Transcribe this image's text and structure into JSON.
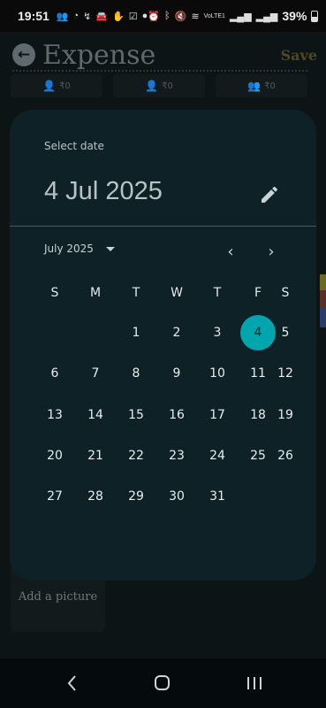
{
  "status_bar": {
    "time": "19:51",
    "notification_icons": [
      "group-icon",
      "whatsapp-icon",
      "missed-call-icon",
      "car-icon",
      "hand-icon",
      "check-box-icon",
      "dot-icon"
    ],
    "system_icons": [
      "alarm-icon",
      "bluetooth-icon",
      "mute-icon",
      "wifi-icon",
      "volte-icon",
      "signal-icon",
      "signal-icon"
    ],
    "volte": "VoLTE1",
    "battery": "39%"
  },
  "page": {
    "title": "Expense",
    "save_label": "Save",
    "split_amounts": [
      "₹0",
      "₹0",
      "₹0"
    ],
    "add_picture_label": "Add a picture"
  },
  "date_picker": {
    "supporting_text": "Select date",
    "headline": "4 Jul 2025",
    "month_year": "July 2025",
    "weekdays": [
      "S",
      "M",
      "T",
      "W",
      "T",
      "F",
      "S"
    ],
    "days": [
      "1",
      "2",
      "3",
      "4",
      "5",
      "6",
      "7",
      "8",
      "9",
      "10",
      "11",
      "12",
      "13",
      "14",
      "15",
      "16",
      "17",
      "18",
      "19",
      "20",
      "21",
      "22",
      "23",
      "24",
      "25",
      "26",
      "27",
      "28",
      "29",
      "30",
      "31"
    ],
    "first_weekday_index": 2,
    "selected_day": 4,
    "accent_color": "#00a5ad"
  }
}
